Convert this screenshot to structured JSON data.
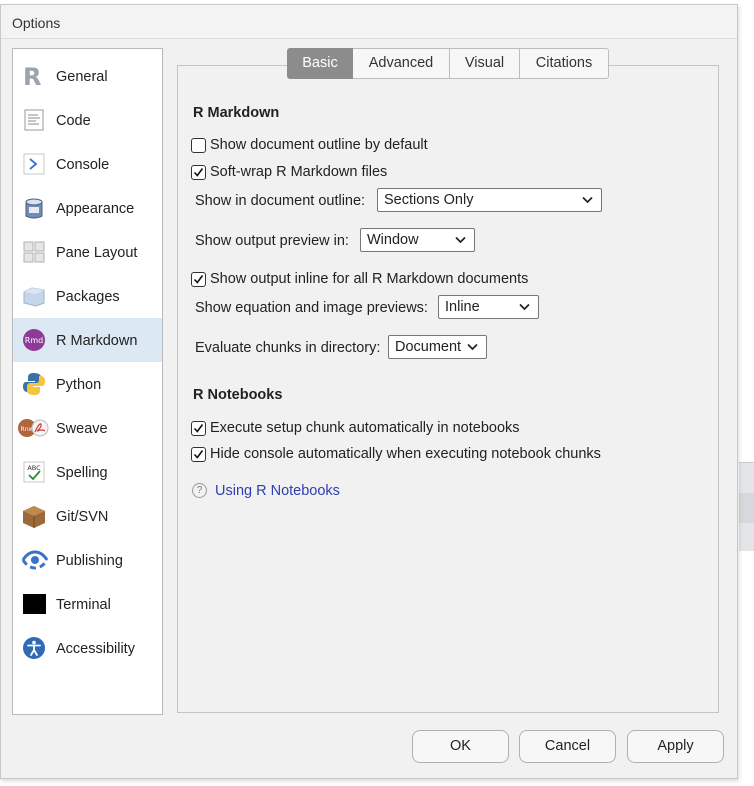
{
  "window": {
    "title": "Options"
  },
  "sidebar": {
    "items": [
      {
        "label": "General",
        "icon": "r-logo-icon"
      },
      {
        "label": "Code",
        "icon": "code-document-icon"
      },
      {
        "label": "Console",
        "icon": "console-prompt-icon"
      },
      {
        "label": "Appearance",
        "icon": "paint-bucket-icon"
      },
      {
        "label": "Pane Layout",
        "icon": "pane-layout-icon"
      },
      {
        "label": "Packages",
        "icon": "package-box-icon"
      },
      {
        "label": "R Markdown",
        "icon": "rmd-icon"
      },
      {
        "label": "Python",
        "icon": "python-icon"
      },
      {
        "label": "Sweave",
        "icon": "sweave-pdf-icon"
      },
      {
        "label": "Spelling",
        "icon": "spelling-abc-icon"
      },
      {
        "label": "Git/SVN",
        "icon": "git-box-icon"
      },
      {
        "label": "Publishing",
        "icon": "publishing-icon"
      },
      {
        "label": "Terminal",
        "icon": "terminal-icon"
      },
      {
        "label": "Accessibility",
        "icon": "accessibility-icon"
      }
    ],
    "selected": "R Markdown"
  },
  "tabs": [
    "Basic",
    "Advanced",
    "Visual",
    "Citations"
  ],
  "active_tab": "Basic",
  "rmarkdown": {
    "section_title": "R Markdown",
    "show_outline_default": {
      "label": "Show document outline by default",
      "checked": false
    },
    "soft_wrap": {
      "label": "Soft-wrap R Markdown files",
      "checked": true
    },
    "doc_outline": {
      "label": "Show in document outline:",
      "value": "Sections Only"
    },
    "output_preview": {
      "label": "Show output preview in:",
      "value": "Window"
    },
    "output_inline": {
      "label": "Show output inline for all R Markdown documents",
      "checked": true
    },
    "equation_previews": {
      "label": "Show equation and image previews:",
      "value": "Inline"
    },
    "eval_dir": {
      "label": "Evaluate chunks in directory:",
      "value": "Document"
    }
  },
  "notebooks": {
    "section_title": "R Notebooks",
    "setup_chunk": {
      "label": "Execute setup chunk automatically in notebooks",
      "checked": true
    },
    "hide_console": {
      "label": "Hide console automatically when executing notebook chunks",
      "checked": true
    },
    "help_link": "Using R Notebooks"
  },
  "buttons": {
    "ok": "OK",
    "cancel": "Cancel",
    "apply": "Apply"
  },
  "colors": {
    "selected_bg": "#dde8f5",
    "active_tab_bg": "#8c8c8c",
    "link": "#2f3fae"
  }
}
